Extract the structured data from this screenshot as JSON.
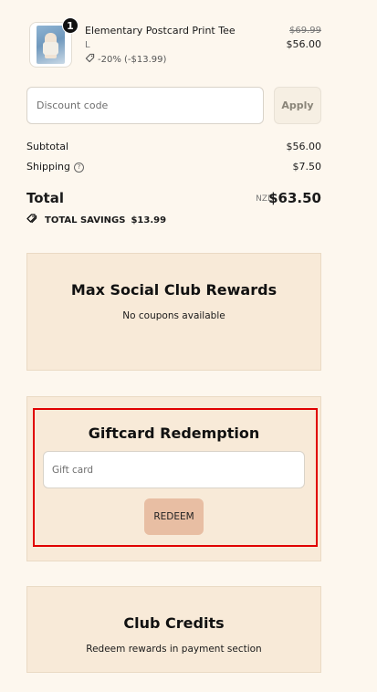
{
  "product": {
    "quantity": "1",
    "name": "Elementary Postcard Print Tee",
    "variant": "L",
    "discount_label": "-20% (-$13.99)",
    "original_price": "$69.99",
    "price": "$56.00"
  },
  "discount": {
    "placeholder": "Discount code",
    "apply_label": "Apply"
  },
  "totals": {
    "subtotal_label": "Subtotal",
    "subtotal_value": "$56.00",
    "shipping_label": "Shipping",
    "shipping_value": "$7.50",
    "total_label": "Total",
    "currency": "NZD",
    "total_value": "$63.50",
    "savings_label": "TOTAL SAVINGS",
    "savings_value": "$13.99"
  },
  "rewards": {
    "title": "Max Social Club Rewards",
    "subtitle": "No coupons available"
  },
  "giftcard": {
    "title": "Giftcard Redemption",
    "placeholder": "Gift card",
    "redeem_label": "REDEEM"
  },
  "credits": {
    "title": "Club Credits",
    "subtitle": "Redeem rewards in payment section"
  },
  "colors": {
    "page_bg": "#fdf7ee",
    "panel_bg": "#f8ead8",
    "redeem_button": "#e8bea3",
    "highlight_border": "#e00000"
  },
  "icons": [
    "tag-icon",
    "help-circle-icon",
    "tags-icon"
  ]
}
